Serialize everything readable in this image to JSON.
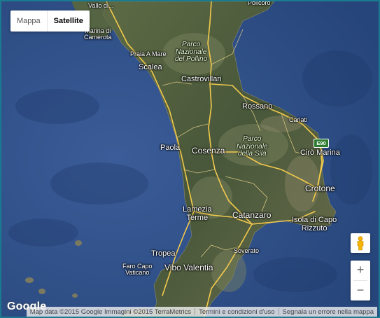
{
  "map_controls": {
    "map_type_options": [
      "Mappa",
      "Satellite"
    ],
    "selected_map_type": "Satellite",
    "zoom_in_label": "+",
    "zoom_out_label": "−"
  },
  "branding": {
    "logo_text": "Google"
  },
  "attribution": {
    "map_data": "Map data ©2015 Google Immagini ©2015 TerraMetrics",
    "terms": "Termini e condizioni d'uso",
    "report": "Segnala un errore nella mappa"
  },
  "places": {
    "vallo_di": "Vallo di...",
    "policoro": "Policoro",
    "marina_di_camerota": "Marina di\nCamerota",
    "parco_pollino": "Parco\nNazionale\ndel Pollino",
    "praia_a_mare": "Praia A Mare",
    "scalea": "Scalea",
    "castrovillari": "Castrovillari",
    "rossano": "Rossano",
    "cariati": "Cariati",
    "parco_sila": "Parco\nNazionale\ndella Sila",
    "paola": "Paola",
    "cosenza": "Cosenza",
    "ciro_marina": "Cirò Marina",
    "crotone": "Crotone",
    "lamezia_terme": "Lamezia\nTerme",
    "catanzaro": "Catanzaro",
    "isola_di_capo_rizzuto": "Isola di Capo\nRizzuto",
    "soverato": "Soverato",
    "tropea": "Tropea",
    "vibo_valentia": "Vibo Valentia",
    "faro_capo_vaticano": "Faro Capo\nVaticano"
  },
  "road_shield": "E90",
  "colors": {
    "sea": "#2f4f86",
    "sea_light": "#3d5f99",
    "land": "#4a5a38",
    "land_light": "#6b7550",
    "road_major": "#f2c94c",
    "road_minor": "#e8d48a",
    "frame_border": "#1a7a8f"
  },
  "icons": [
    "pegman-icon",
    "zoom-in-icon",
    "zoom-out-icon"
  ]
}
